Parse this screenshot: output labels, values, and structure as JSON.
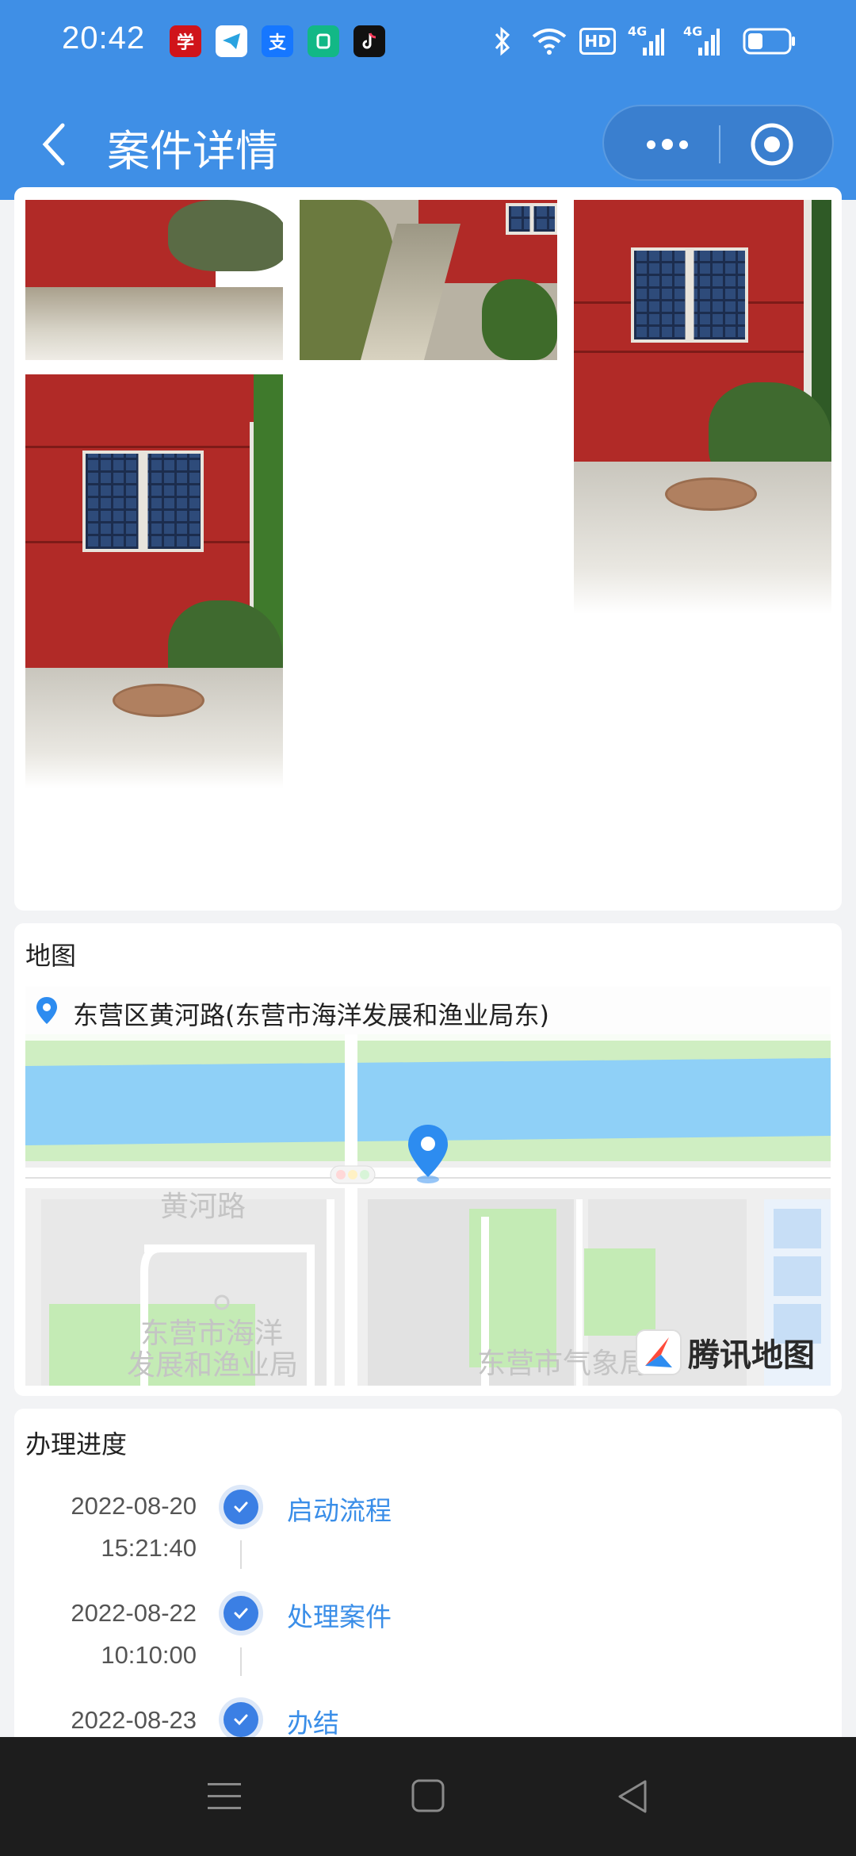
{
  "status_bar": {
    "time": "20:42",
    "app_icons": [
      "xuexi-icon",
      "telegram-icon",
      "alipay-icon",
      "app-icon",
      "douyin-icon"
    ],
    "indicators": [
      "bluetooth-icon",
      "wifi-icon",
      "hd-icon",
      "signal-4g-icon",
      "signal-4g-icon",
      "battery-icon"
    ],
    "hd_label": "HD",
    "net_label": "4G"
  },
  "header": {
    "title": "案件详情",
    "back_icon": "chevron-left-icon",
    "more_icon": "more-icon",
    "close_icon": "target-icon",
    "bg_color": "#3f8fe6"
  },
  "map_section": {
    "title": "地图",
    "address": "东营区黄河路(东营市海洋发展和渔业局东)",
    "road_label": "黄河路",
    "poi_label_1": "东营市海洋",
    "poi_label_2": "发展和渔业局",
    "poi_label_3": "东营市气象局",
    "provider": "腾讯地图"
  },
  "progress_section": {
    "title": "办理进度",
    "steps": [
      {
        "date": "2022-08-20",
        "time": "15:21:40",
        "label": "启动流程"
      },
      {
        "date": "2022-08-22",
        "time": "10:10:00",
        "label": "处理案件"
      },
      {
        "date": "2022-08-23",
        "time": "",
        "label": "办结"
      }
    ],
    "accent_color": "#3b7fe4"
  },
  "system_nav": {
    "icons": [
      "menu-icon",
      "home-icon",
      "back-triangle-icon"
    ]
  }
}
